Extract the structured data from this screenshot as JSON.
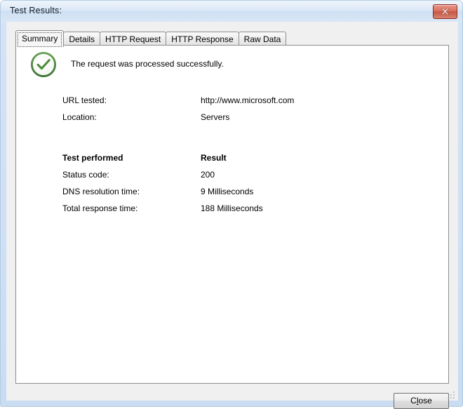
{
  "window": {
    "title": "Test Results:",
    "close_icon": "close-x-icon",
    "resize_grip": "resize-grip"
  },
  "tabs": [
    {
      "label": "Summary",
      "selected": true
    },
    {
      "label": "Details",
      "selected": false
    },
    {
      "label": "HTTP Request",
      "selected": false
    },
    {
      "label": "HTTP Response",
      "selected": false
    },
    {
      "label": "Raw Data",
      "selected": false
    }
  ],
  "summary": {
    "status_icon": "success-check-circle-icon",
    "status_message": "The request was processed successfully.",
    "info": [
      {
        "label": "URL tested:",
        "value": "http://www.microsoft.com"
      },
      {
        "label": "Location:",
        "value": "Servers"
      }
    ],
    "results_header": {
      "label": "Test performed",
      "value": "Result"
    },
    "results": [
      {
        "label": "Status code:",
        "value": "200"
      },
      {
        "label": "DNS resolution time:",
        "value": "9 Milliseconds"
      },
      {
        "label": "Total response time:",
        "value": "188 Milliseconds"
      }
    ]
  },
  "footer": {
    "close_button": {
      "pre": "C",
      "accel": "l",
      "post": "ose",
      "full": "Close"
    }
  },
  "colors": {
    "success_green": "#4f8a3f",
    "titlebar_blue": "#cfe0f3",
    "close_red": "#c45744",
    "panel_white": "#ffffff",
    "dialog_gray": "#f0f0f0"
  }
}
